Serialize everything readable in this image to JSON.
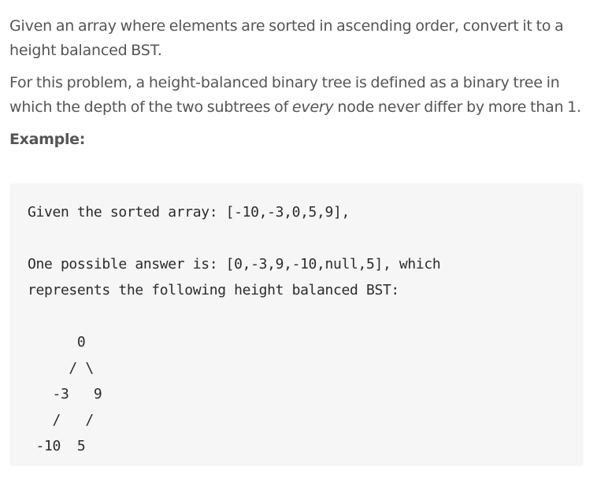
{
  "problem": {
    "paragraph1": "Given an array where elements are sorted in ascending order, convert it to a height balanced BST.",
    "paragraph2_before": "For this problem, a height-balanced binary tree is defined as a binary tree in which the depth of the two subtrees of ",
    "paragraph2_emphasis": "every",
    "paragraph2_after": " node never differ by more than 1.",
    "example_label": "Example:"
  },
  "example_code": {
    "lines": [
      "Given the sorted array: [-10,-3,0,5,9],",
      "",
      "One possible answer is: [0,-3,9,-10,null,5], which",
      "represents the following height balanced BST:",
      "",
      "      0",
      "     / \\",
      "   -3   9",
      "   /   /",
      " -10  5"
    ]
  }
}
